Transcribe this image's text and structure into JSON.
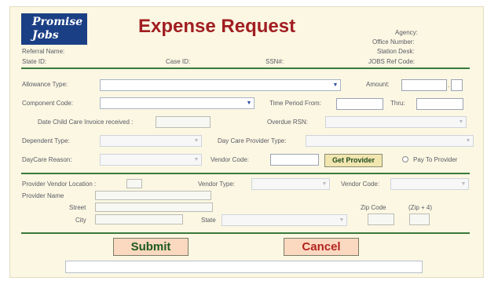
{
  "logo": {
    "line1": "Promise",
    "line2": "Jobs"
  },
  "title": "Expense Request",
  "header": {
    "agency": "Agency:",
    "office_number": "Office Number:",
    "station_desk": "Station Desk:",
    "jobs_ref_code": "JOBS Ref Code:",
    "referral_name": "Referral Name:",
    "state_id": "State ID:",
    "case_id": "Case ID:",
    "ssn": "SSN#:"
  },
  "form": {
    "allowance_type": "Allowance Type:",
    "amount": "Amount:",
    "amount_sep": ".",
    "component_code": "Component Code:",
    "time_period_from": "Time Period From:",
    "thru": "Thru:",
    "date_child_care": "Date Child Care Invoice received :",
    "overdue_rsn": "Overdue RSN:",
    "dependent_type": "Dependent Type:",
    "day_care_provider_type": "Day Care Provider Type:",
    "daycare_reason": "DayCare Reason:",
    "vendor_code": "Vendor Code:",
    "get_provider": "Get Provider",
    "pay_to_provider": "Pay To Provider"
  },
  "provider": {
    "location": "Provider Vendor Location :",
    "vendor_type": "Vendor Type:",
    "vendor_code": "Vendor Code:",
    "name": "Provider Name",
    "street": "Street",
    "city": "City",
    "state": "State",
    "zip_code": "Zip Code",
    "zip4": "(Zip + 4)"
  },
  "actions": {
    "submit": "Submit",
    "cancel": "Cancel"
  },
  "colors": {
    "title": "#a11e22",
    "rule": "#3a7a3c",
    "logo": "#1b3f85",
    "panel": "#fbf7e2"
  },
  "icons": {
    "dropdown": "chevron-down-icon",
    "radio": "radio-icon"
  }
}
